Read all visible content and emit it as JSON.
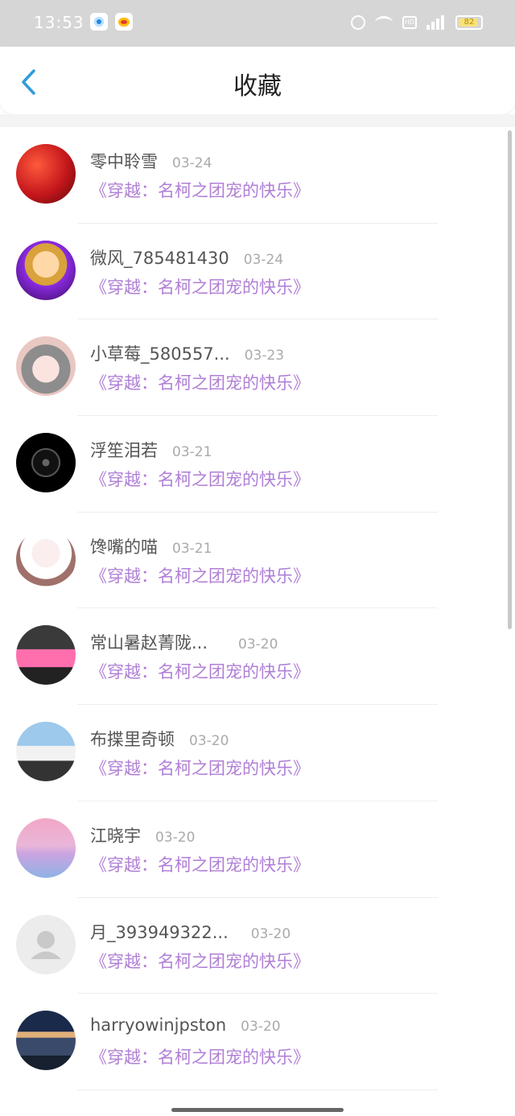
{
  "status_bar": {
    "time": "13:53",
    "battery_level": "82",
    "hd_label": "HD",
    "network_label": "4G"
  },
  "header": {
    "title": "收藏"
  },
  "items": [
    {
      "name": "零中聆雪",
      "date": "03-24",
      "book": "《穿越：名柯之团宠的快乐》"
    },
    {
      "name": "微风_785481430",
      "date": "03-24",
      "book": "《穿越：名柯之团宠的快乐》"
    },
    {
      "name": "小草莓_580557...",
      "date": "03-23",
      "book": "《穿越：名柯之团宠的快乐》"
    },
    {
      "name": "浮笙泪若",
      "date": "03-21",
      "book": "《穿越：名柯之团宠的快乐》"
    },
    {
      "name": "馋嘴的喵",
      "date": "03-21",
      "book": "《穿越：名柯之团宠的快乐》"
    },
    {
      "name": "常山暑赵菁陇...",
      "date": "03-20",
      "book": "《穿越：名柯之团宠的快乐》"
    },
    {
      "name": "布揲里奇顿",
      "date": "03-20",
      "book": "《穿越：名柯之团宠的快乐》"
    },
    {
      "name": "江晓宇",
      "date": "03-20",
      "book": "《穿越：名柯之团宠的快乐》"
    },
    {
      "name": "月_393949322...",
      "date": "03-20",
      "book": "《穿越：名柯之团宠的快乐》"
    },
    {
      "name": "harryowinjpston",
      "date": "03-20",
      "book": "《穿越：名柯之团宠的快乐》"
    }
  ],
  "colors": {
    "accent_blue": "#2d9cdb",
    "book_title": "#b07fd6",
    "status_bar_bg": "#d6d6d6"
  }
}
